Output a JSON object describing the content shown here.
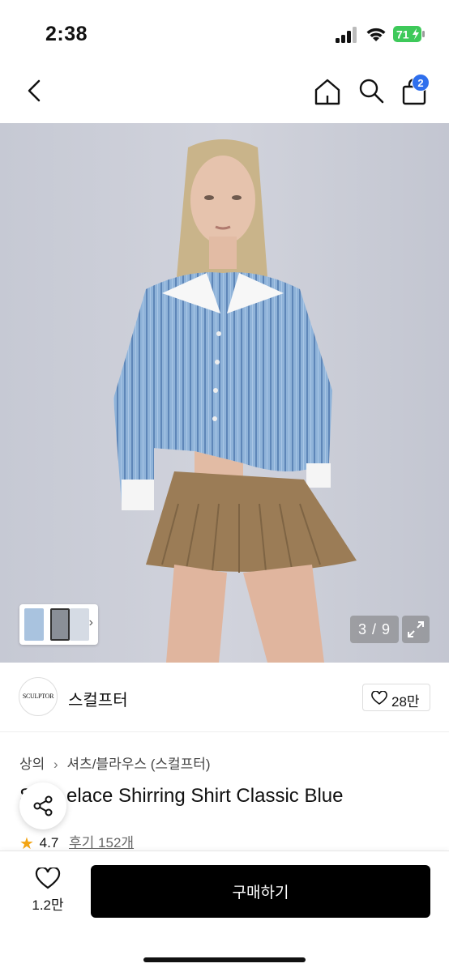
{
  "status_bar": {
    "time": "2:38",
    "battery_level": "71"
  },
  "nav": {
    "cart_count": "2",
    "icons": [
      "back-icon",
      "home-icon",
      "search-icon",
      "cart-icon"
    ]
  },
  "gallery": {
    "counter": "3 / 9",
    "current_index": 3,
    "total": 9
  },
  "brand": {
    "logo_text": "SCULPTOR",
    "name": "스컬프터",
    "likes": "28만"
  },
  "product": {
    "breadcrumb": [
      "상의",
      "셔츠/블라우스 (스컬프터)"
    ],
    "title": "S Lace Shirring Shirt Classic Blue",
    "title_visible": "elace Shirring Shirt Classic Blue",
    "rating": "4.7",
    "reviews": "후기 152개"
  },
  "bottom_bar": {
    "wishlist_count": "1.2만",
    "buy_label": "구매하기"
  },
  "colors": {
    "accent_blue": "#2f6fed",
    "star": "#f3a412",
    "buy_button": "#000000"
  }
}
